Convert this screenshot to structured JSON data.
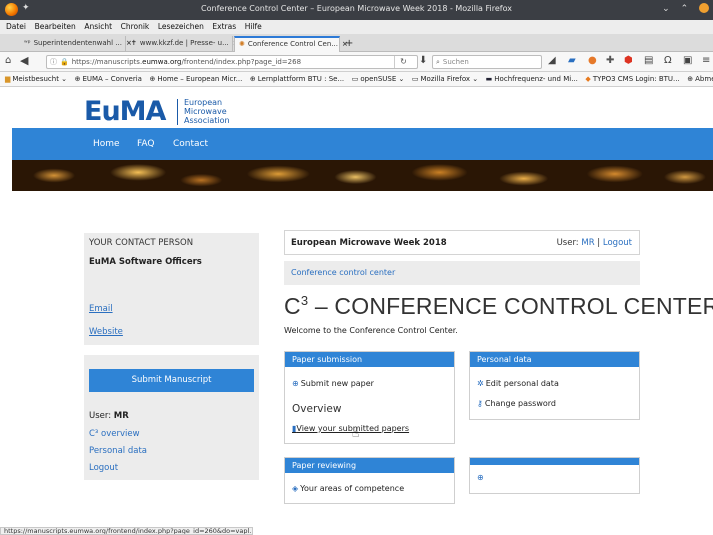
{
  "window": {
    "title": "Conference Control Center – European Microwave Week 2018 - Mozilla Firefox"
  },
  "menubar": [
    "Datei",
    "Bearbeiten",
    "Ansicht",
    "Chronik",
    "Lesezeichen",
    "Extras",
    "Hilfe"
  ],
  "tabs": [
    {
      "label": "Superintendentenwahl ...",
      "icon": "wp",
      "active": false
    },
    {
      "label": "www.kkzf.de | Presse- u...",
      "icon": "cross",
      "active": false
    },
    {
      "label": "Conference Control Cen...",
      "icon": "spinner",
      "active": true
    }
  ],
  "tab_close": "×",
  "tab_new": "+",
  "navbar": {
    "url_prefix": "https://manuscripts.",
    "url_domain": "eumwa.org",
    "url_suffix": "/frontend/index.php?page_id=268",
    "search_placeholder": "Suchen"
  },
  "bookmarks": [
    "Meistbesucht",
    "EUMA – Converia",
    "Home – European Micr...",
    "Lernplattform BTU : Se...",
    "openSUSE",
    "Mozilla Firefox",
    "Hochfrequenz- und Mi...",
    "TYPO3 CMS Login: BTU...",
    "Abmelden"
  ],
  "logo": {
    "wordmark": "EuMA",
    "line1": "European",
    "line2": "Microwave",
    "line3": "Association"
  },
  "nav": [
    "Home",
    "FAQ",
    "Contact"
  ],
  "contact": {
    "title": "YOUR CONTACT PERSON",
    "name": "EuMA Software Officers",
    "email": "Email",
    "website": "Website"
  },
  "userpanel": {
    "submit_button": "Submit Manuscript",
    "user_label": "User: ",
    "user_value": "MR",
    "link_overview": "C³ overview",
    "link_personal": "Personal data",
    "link_logout": "Logout"
  },
  "header": {
    "event": "European Microwave Week 2018",
    "user_label": "User: ",
    "user_value": "MR",
    "separator": " | ",
    "logout": "Logout"
  },
  "breadcrumb": "Conference control center",
  "main": {
    "title_c": "C",
    "title_sup": "3",
    "title_rest": " – CONFERENCE CONTROL CENTER",
    "welcome": "Welcome to the Conference Control Center."
  },
  "cards": {
    "paper_submission": {
      "head": "Paper submission",
      "item": "Submit new paper",
      "overview": "Overview",
      "view_link": "View your submitted papers"
    },
    "personal_data": {
      "head": "Personal data",
      "item1": "Edit personal data",
      "item2": "Change password"
    },
    "paper_reviewing": {
      "head": "Paper reviewing",
      "item": "Your areas of competence"
    }
  },
  "statusbar": "https://manuscripts.eumwa.org/frontend/index.php?page_id=260&do=vapl...",
  "colors": {
    "accent_blue": "#2f84d6",
    "link_blue": "#2a6fc0",
    "panel_grey": "#ececec",
    "logo_blue": "#1a5aa8"
  }
}
